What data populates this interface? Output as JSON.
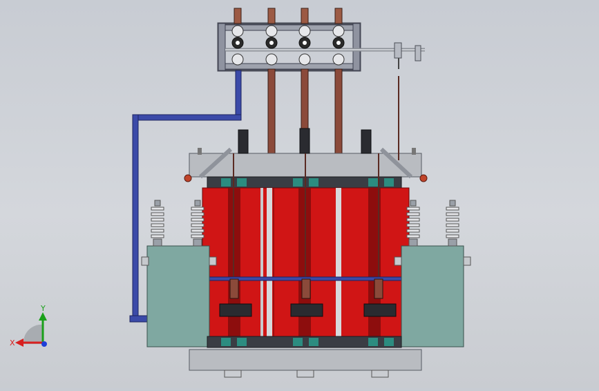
{
  "viewport": {
    "model": "transformer-assembly",
    "view": "front",
    "render_style": "shaded-with-edges",
    "background": "#cfd2d7"
  },
  "triad": {
    "x_label": "X",
    "y_label": "Y",
    "colors": {
      "x": "#d81f1f",
      "y": "#1aa01a",
      "z": "#1f3fd8"
    }
  },
  "colors": {
    "coil": "#d01515",
    "coil_dark": "#8d0d0d",
    "tank_green": "#7fa8a1",
    "frame_blue": "#3b4aa8",
    "busbar_copper": "#8b4a3a",
    "bracket_grey": "#b9bcc1",
    "core_dark": "#3a3d44",
    "teal_block": "#2c8c80"
  }
}
